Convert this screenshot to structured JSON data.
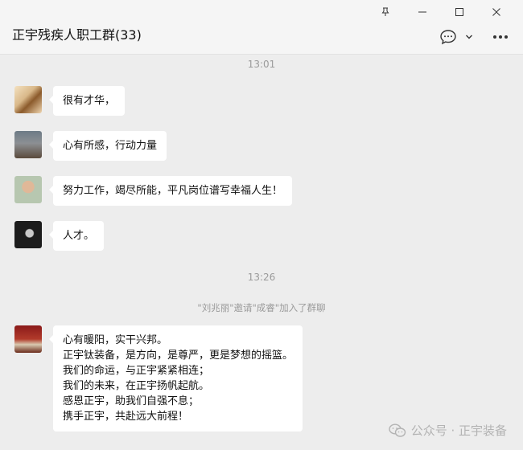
{
  "window": {
    "title": "正宇残疾人职工群(33)"
  },
  "timestamps": [
    "13:01",
    "13:26"
  ],
  "system_message": "\"刘兆丽\"邀请\"成睿\"加入了群聊",
  "messages": [
    {
      "lines": [
        "很有才华，"
      ]
    },
    {
      "lines": [
        "心有所感，行动力量"
      ]
    },
    {
      "lines": [
        "努力工作，竭尽所能，平凡岗位谱写幸福人生！"
      ]
    },
    {
      "lines": [
        "人才。"
      ]
    },
    {
      "lines": [
        "心有暖阳，实干兴邦。",
        "正宇钛装备，是方向，是尊严，更是梦想的摇篮。",
        "我们的命运，与正宇紧紧相连；",
        "我们的未来，在正宇扬帆起航。",
        "感恩正宇，助我们自强不息；",
        "携手正宇，共赴远大前程！"
      ]
    }
  ],
  "watermark": {
    "text": "公众号 · 正宇装备"
  },
  "icons": {
    "pin": "pin-icon",
    "minimize": "minimize-icon",
    "maximize": "maximize-icon",
    "close": "close-icon",
    "chat_bubble": "chat-bubble-icon",
    "dropdown": "chevron-down-icon",
    "more": "more-icon"
  },
  "colors": {
    "background": "#ededed",
    "bubble": "#ffffff",
    "meta_text": "#9a9a9a"
  }
}
